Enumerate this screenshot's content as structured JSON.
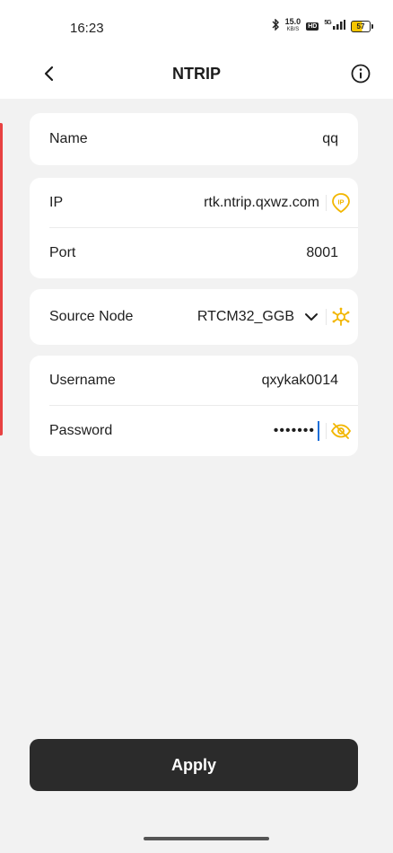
{
  "status_bar": {
    "time": "16:23",
    "net_speed_value": "15.0",
    "net_speed_unit": "KB/S",
    "hd_label": "HD",
    "signal_label": "5G",
    "battery_level": "57"
  },
  "nav": {
    "title": "NTRIP"
  },
  "form": {
    "name_label": "Name",
    "name_value": "qq",
    "ip_label": "IP",
    "ip_value": "rtk.ntrip.qxwz.com",
    "port_label": "Port",
    "port_value": "8001",
    "source_node_label": "Source Node",
    "source_node_value": "RTCM32_GGB",
    "username_label": "Username",
    "username_value": "qxykak0014",
    "password_label": "Password",
    "password_value": "•••••••"
  },
  "apply_label": "Apply",
  "colors": {
    "accent_icon": "#f2b600",
    "apply_bg": "#2b2b2b",
    "cursor": "#1e6fd9",
    "side_accent": "#e84242"
  }
}
